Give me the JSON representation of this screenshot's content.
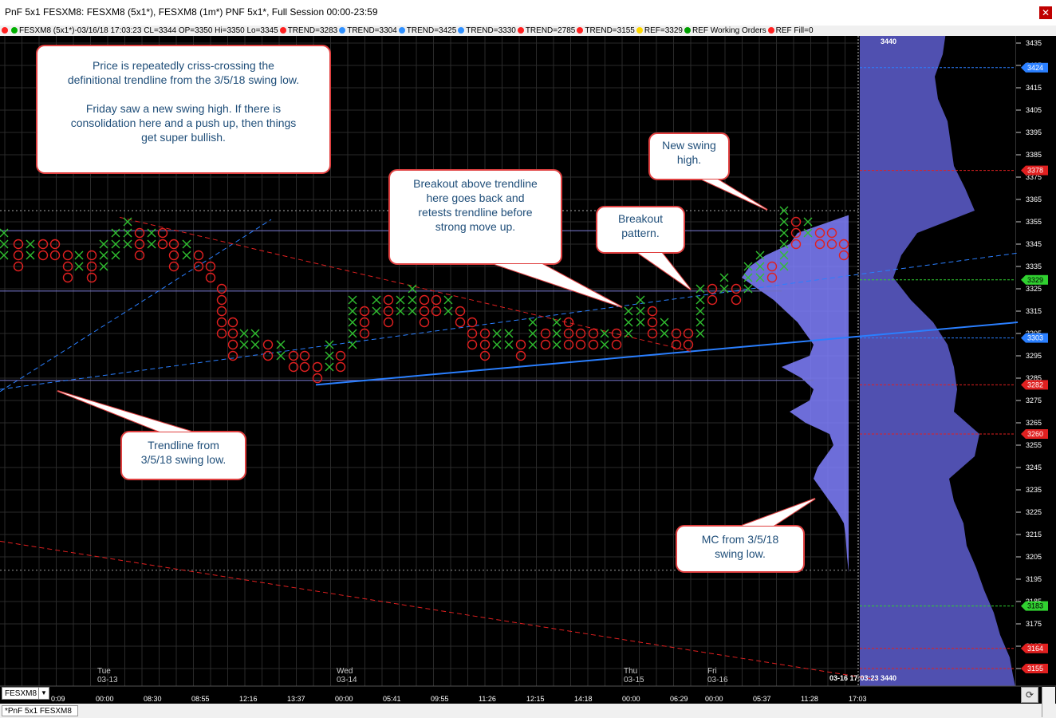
{
  "window": {
    "title": "PnF 5x1 FESXM8: FESXM8 (5x1*), FESXM8 (1m*) PNF 5x1*, Full Session 00:00-23:59",
    "close_glyph": "✕"
  },
  "infobar": {
    "symbol_info": "FESXM8 (5x1*)-03/16/18 17:03:23 CL=3344 OP=3350 Hi=3350 Lo=3345",
    "studies": [
      {
        "label": "TREND=3283",
        "color": "#ff2020"
      },
      {
        "label": "TREND=3304",
        "color": "#3090ff"
      },
      {
        "label": "TREND=3425",
        "color": "#3090ff"
      },
      {
        "label": "TREND=3330",
        "color": "#3090ff"
      },
      {
        "label": "TREND=2785",
        "color": "#ff2020"
      },
      {
        "label": "TREND=3155",
        "color": "#ff2020"
      },
      {
        "label": "REF=3329",
        "color": "#ffd800"
      },
      {
        "label": "REF Working Orders",
        "color": "#00a000"
      },
      {
        "label": "REF Fill=0",
        "color": "#ff2020"
      }
    ]
  },
  "price_axis": {
    "ticks": [
      "3435",
      "3425",
      "3415",
      "3405",
      "3395",
      "3385",
      "3375",
      "3365",
      "3355",
      "3345",
      "3335",
      "3325",
      "3315",
      "3305",
      "3295",
      "3285",
      "3275",
      "3265",
      "3255",
      "3245",
      "3235",
      "3225",
      "3215",
      "3205",
      "3195",
      "3185",
      "3175",
      "3165",
      "3155"
    ],
    "current_price": "3440",
    "tags": [
      {
        "label": "3424",
        "price": 3424,
        "color": "#2a7fff",
        "text": "#ffffff"
      },
      {
        "label": "3378",
        "price": 3378,
        "color": "#e02020",
        "text": "#ffffff"
      },
      {
        "label": "3329",
        "price": 3329,
        "color": "#30d030",
        "text": "#000000"
      },
      {
        "label": "3303",
        "price": 3303,
        "color": "#2a7fff",
        "text": "#ffffff"
      },
      {
        "label": "3282",
        "price": 3282,
        "color": "#e02020",
        "text": "#ffffff"
      },
      {
        "label": "3260",
        "price": 3260,
        "color": "#e02020",
        "text": "#ffffff"
      },
      {
        "label": "3183",
        "price": 3183,
        "color": "#30d030",
        "text": "#000000"
      },
      {
        "label": "3164",
        "price": 3164,
        "color": "#e02020",
        "text": "#ffffff"
      },
      {
        "label": "3155",
        "price": 3155,
        "color": "#e02020",
        "text": "#ffffff"
      }
    ]
  },
  "time_axis": {
    "labels": [
      "0:09",
      "00:00",
      "08:30",
      "08:55",
      "12:16",
      "13:37",
      "00:00",
      "05:41",
      "09:55",
      "11:26",
      "12:15",
      "14:18",
      "00:00",
      "06:29",
      "00:00",
      "05:37",
      "11:28",
      "17:03"
    ],
    "dates": [
      {
        "day": "Tue",
        "date": "03-13"
      },
      {
        "day": "Wed",
        "date": "03-14"
      },
      {
        "day": "Thu",
        "date": "03-15"
      },
      {
        "day": "Fri",
        "date": "03-16"
      }
    ],
    "last_stamp": "03-16 17:03:23  3440"
  },
  "callouts": [
    {
      "lines": [
        "Price is repeatedly criss-crossing the",
        "definitional trendline from the 3/5/18 swing low.",
        "",
        "Friday saw a new swing high. If there is",
        "consolidation here and a push up, then things",
        "get super bullish."
      ]
    },
    {
      "lines": [
        "New swing",
        "high."
      ]
    },
    {
      "lines": [
        "Breakout above trendline",
        "here goes back and",
        "retests trendline before",
        "strong move up."
      ]
    },
    {
      "lines": [
        "Breakout",
        "pattern."
      ]
    },
    {
      "lines": [
        "Trendline from",
        "3/5/18 swing low."
      ]
    },
    {
      "lines": [
        "MC from 3/5/18",
        "swing low."
      ]
    }
  ],
  "bottom": {
    "symbol_select": "FESXM8",
    "tab_label": "*PnF 5x1 FESXM8",
    "refresh_glyph": "⟳",
    "dropdown_glyph": "▼"
  },
  "colors": {
    "x_mark": "#30c030",
    "o_mark": "#e02020",
    "grid": "#2a2a2a",
    "profile": "#8080ff",
    "trend_blue": "#2a7fff",
    "trend_red": "#e02020"
  }
}
